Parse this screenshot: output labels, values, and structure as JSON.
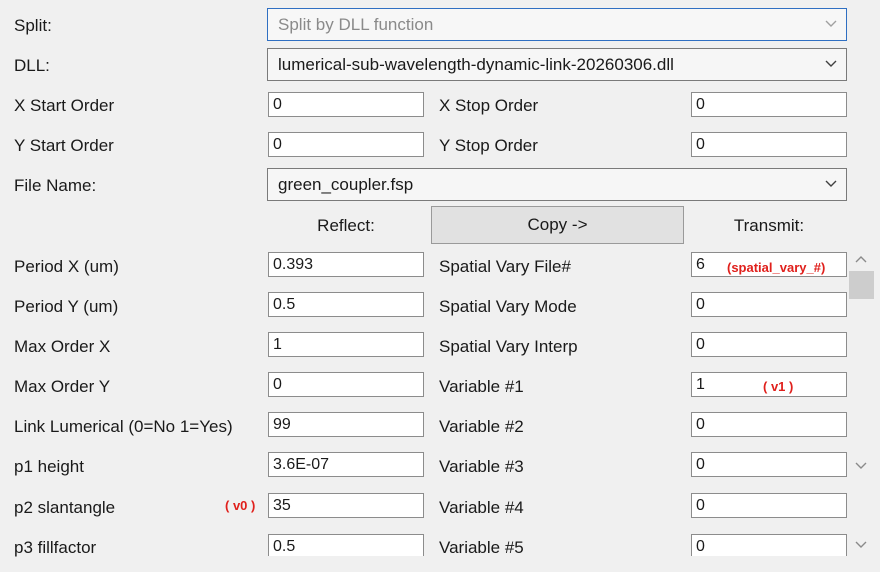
{
  "top": {
    "split_label": "Split:",
    "split_value": "Split by DLL function",
    "dll_label": "DLL:",
    "dll_value": "lumerical-sub-wavelength-dynamic-link-20260306.dll",
    "x_start_label": "X Start Order",
    "x_start_value": "0",
    "x_stop_label": "X Stop Order",
    "x_stop_value": "0",
    "y_start_label": "Y Start Order",
    "y_start_value": "0",
    "y_stop_label": "Y Stop Order",
    "y_stop_value": "0",
    "file_label": "File Name:",
    "file_value": "green_coupler.fsp"
  },
  "headers": {
    "reflect": "Reflect:",
    "copy_button": "Copy ->",
    "transmit": "Transmit:"
  },
  "left_rows": [
    {
      "label": "Period X (um)",
      "value": "0.393"
    },
    {
      "label": "Period Y (um)",
      "value": "0.5"
    },
    {
      "label": "Max Order X",
      "value": "1"
    },
    {
      "label": "Max Order Y",
      "value": "0"
    },
    {
      "label": "Link Lumerical (0=No 1=Yes)",
      "value": "99"
    },
    {
      "label": "p1 height",
      "value": "3.6E-07"
    },
    {
      "label": "p2 slantangle",
      "value": "35"
    },
    {
      "label": "p3 fillfactor",
      "value": "0.5"
    }
  ],
  "right_rows": [
    {
      "label": "Spatial Vary File#",
      "value": "6"
    },
    {
      "label": "Spatial Vary Mode",
      "value": "0"
    },
    {
      "label": "Spatial Vary Interp",
      "value": "0"
    },
    {
      "label": "Variable #1",
      "value": "1"
    },
    {
      "label": "Variable #2",
      "value": "0"
    },
    {
      "label": "Variable #3",
      "value": "0"
    },
    {
      "label": "Variable #4",
      "value": "0"
    },
    {
      "label": "Variable #5",
      "value": "0"
    }
  ],
  "annotations": {
    "spatial_vary": "(spatial_vary_#)",
    "v1": "( v1 )",
    "v0": "( v0 )"
  },
  "colors": {
    "annotation": "#e0201c",
    "disabled_border": "#2f6fc2"
  }
}
